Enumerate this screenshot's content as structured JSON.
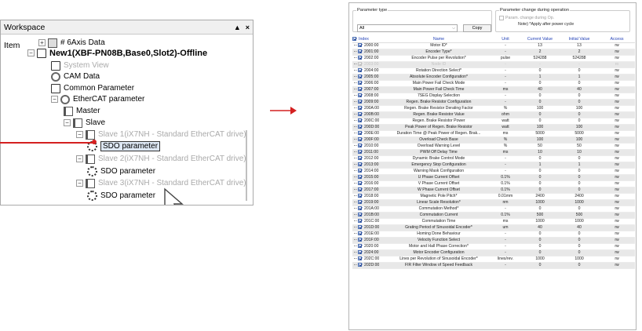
{
  "workspace": {
    "title": "Workspace",
    "pin": "▲",
    "close": "×",
    "root_label": "Item",
    "tree": [
      {
        "label": "# 6Axis Data",
        "icon": "folder-icon",
        "style": "normal"
      },
      {
        "label": "New1(XBF-PN08B,Base0,Slot2)-Offline",
        "icon": "module-icon",
        "style": "bold"
      },
      {
        "label": "System View",
        "icon": "system-view-icon",
        "style": "gray"
      },
      {
        "label": "CAM Data",
        "icon": "cam-icon",
        "style": "normal"
      },
      {
        "label": "Common Parameter",
        "icon": "parameter-icon",
        "style": "normal"
      },
      {
        "label": "EtherCAT parameter",
        "icon": "ethercat-icon",
        "style": "normal"
      },
      {
        "label": "Master",
        "icon": "master-icon",
        "style": "normal"
      },
      {
        "label": "Slave",
        "icon": "slave-icon",
        "style": "normal"
      },
      {
        "label": "Slave  1(iX7NH - Standard EtherCAT drive)",
        "icon": "drive-icon",
        "style": "gray"
      },
      {
        "label": "SDO parameter",
        "icon": "sdo-gear-icon",
        "style": "selected"
      },
      {
        "label": "Slave  2(iX7NH - Standard EtherCAT drive)",
        "icon": "drive-icon",
        "style": "gray"
      },
      {
        "label": "SDO parameter",
        "icon": "sdo-gear-icon",
        "style": "normal"
      },
      {
        "label": "Slave  3(iX7NH - Standard EtherCAT drive)",
        "icon": "drive-icon",
        "style": "gray"
      },
      {
        "label": "SDO parameter",
        "icon": "sdo-gear-icon",
        "style": "normal"
      }
    ]
  },
  "params": {
    "type_group_title": "Parameter type",
    "type_select_value": "All",
    "copy_label": "Copy",
    "change_group_title": "Parameter change during operation",
    "change_checkbox_label": "Param. change during Op.",
    "change_note": "Note) *Apply after power cycle",
    "columns": [
      "Index",
      "Name",
      "Unit",
      "Current Value",
      "Initial Value",
      "Access"
    ],
    "rows": [
      [
        "2000:00",
        "Motor ID*",
        "-",
        "13",
        "13",
        "rw"
      ],
      [
        "2001:00",
        "Encoder Type*",
        "-",
        "2",
        "2",
        "rw"
      ],
      [
        "2002:00",
        "Encoder Pulse per Revolution*",
        "pulse",
        "524288",
        "524288",
        "rw"
      ],
      [
        "2003:00",
        "Node ID",
        "-",
        "-",
        "-",
        "ro"
      ],
      [
        "2004:00",
        "Rotation Direction Select*",
        "-",
        "0",
        "0",
        "rw"
      ],
      [
        "2005:00",
        "Absolute Encoder Configuration*",
        "-",
        "1",
        "1",
        "rw"
      ],
      [
        "2006:00",
        "Main Power Fail Check Mode",
        "-",
        "0",
        "0",
        "rw"
      ],
      [
        "2007:00",
        "Main Power Fail Check Time",
        "ms",
        "40",
        "40",
        "rw"
      ],
      [
        "2008:00",
        "7SEG Display Selection",
        "-",
        "0",
        "0",
        "rw"
      ],
      [
        "2009:00",
        "Regen. Brake Resistor Configuration",
        "-",
        "0",
        "0",
        "rw"
      ],
      [
        "200A:00",
        "Regen. Brake Resistor Derating Factor",
        "%",
        "100",
        "100",
        "rw"
      ],
      [
        "200B:00",
        "Regen. Brake Resistor Value",
        "ohm",
        "0",
        "0",
        "rw"
      ],
      [
        "200C:00",
        "Regen. Brake Resistor Power",
        "watt",
        "0",
        "0",
        "rw"
      ],
      [
        "200D:00",
        "Peak Power of Regen. Brake Resistor",
        "watt",
        "100",
        "100",
        "rw"
      ],
      [
        "200E:00",
        "Duration Time @ Peak Power of Regen. Brak...",
        "ms",
        "5000",
        "5000",
        "rw"
      ],
      [
        "200F:00",
        "Overload Check Base",
        "%",
        "100",
        "100",
        "rw"
      ],
      [
        "2010:00",
        "Overload Warning Level",
        "%",
        "50",
        "50",
        "rw"
      ],
      [
        "2011:00",
        "PWM Off Delay Time",
        "ms",
        "10",
        "10",
        "rw"
      ],
      [
        "2012:00",
        "Dynamic Brake Control Mode",
        "-",
        "0",
        "0",
        "rw"
      ],
      [
        "2013:00",
        "Emergency Stop Configuration",
        "-",
        "1",
        "1",
        "rw"
      ],
      [
        "2014:00",
        "Warning Mask Configuration",
        "-",
        "0",
        "0",
        "rw"
      ],
      [
        "2015:00",
        "U Phase Current Offset",
        "0.1%",
        "0",
        "0",
        "rw"
      ],
      [
        "2016:00",
        "V Phase Current Offset",
        "0.1%",
        "0",
        "0",
        "rw"
      ],
      [
        "2017:00",
        "W Phase Current Offset",
        "0.1%",
        "0",
        "0",
        "rw"
      ],
      [
        "2018:00",
        "Magnetic Pole Pitch*",
        "0.01mm",
        "2400",
        "2400",
        "rw"
      ],
      [
        "2019:00",
        "Linear Scale Resolution*",
        "nm",
        "1000",
        "1000",
        "rw"
      ],
      [
        "201A:00",
        "Commutation Method*",
        "-",
        "0",
        "0",
        "rw"
      ],
      [
        "201B:00",
        "Commutation Current",
        "0.1%",
        "500",
        "500",
        "rw"
      ],
      [
        "201C:00",
        "Commutation Time",
        "ms",
        "1000",
        "1000",
        "rw"
      ],
      [
        "201D:00",
        "Grating Period of Sinusoidal Encoder*",
        "um",
        "40",
        "40",
        "rw"
      ],
      [
        "201E:00",
        "Homing Done Behaviour",
        "-",
        "0",
        "0",
        "rw"
      ],
      [
        "201F:00",
        "Velocity Function Select",
        "-",
        "0",
        "0",
        "rw"
      ],
      [
        "2020:00",
        "Motor and Hall Phase Correction*",
        "-",
        "0",
        "0",
        "rw"
      ],
      [
        "2024:00",
        "Motor Encoder Configuration",
        "-",
        "0",
        "0",
        "rw"
      ],
      [
        "202C:00",
        "Lines per Revolution of Sinusoidal Encoder*",
        "lines/rev.",
        "1000",
        "1000",
        "rw"
      ],
      [
        "202D:00",
        "FIR Filter Window of Speed Feedback",
        "-",
        "0",
        "0",
        "rw"
      ]
    ]
  }
}
